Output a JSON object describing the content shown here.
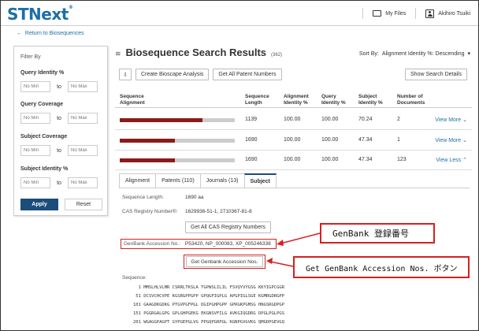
{
  "brand": {
    "logo": "STNext",
    "trademark": "®"
  },
  "topnav": {
    "my_files": "My Files",
    "user": "Akihiro Tsuiki"
  },
  "back_link": "Return to Biosequences",
  "filter": {
    "title": "Filter By",
    "sections": [
      {
        "label": "Query Identity %",
        "min_placeholder": "No Min",
        "max_placeholder": "No Max"
      },
      {
        "label": "Query Coverage",
        "min_placeholder": "No Min",
        "max_placeholder": "No Max"
      },
      {
        "label": "Subject Coverage",
        "min_placeholder": "No Min",
        "max_placeholder": "No Max"
      },
      {
        "label": "Subject Identity %",
        "min_placeholder": "No Min",
        "max_placeholder": "No Max"
      }
    ],
    "to_label": "to",
    "apply": "Apply",
    "reset": "Reset"
  },
  "results": {
    "title": "Biosequence Search Results",
    "count": "(362)",
    "sort_label": "Sort By:",
    "sort_value": "Alignment Identity %: Descending",
    "toolbar": {
      "create_bioscape": "Create Bioscape Analysis",
      "get_patent_numbers": "Get All Patent Numbers",
      "show_search_details": "Show Search Details"
    },
    "columns": {
      "alignment": [
        "Sequence",
        "Alignment"
      ],
      "length": [
        "Sequence",
        "Length"
      ],
      "align_identity": [
        "Alignment",
        "Identity %"
      ],
      "query_identity": [
        "Query",
        "Identity %"
      ],
      "subject_identity": [
        "Subject",
        "Identity %"
      ],
      "documents": [
        "Number of",
        "Documents"
      ]
    },
    "rows": [
      {
        "fill": 0.72,
        "length": "1139",
        "align_identity": "100.00",
        "query_identity": "100.00",
        "subject_identity": "70.24",
        "documents": "2",
        "link": "View More"
      },
      {
        "fill": 0.48,
        "length": "1690",
        "align_identity": "100.00",
        "query_identity": "100.00",
        "subject_identity": "47.34",
        "documents": "1",
        "link": "View More"
      },
      {
        "fill": 0.48,
        "length": "1690",
        "align_identity": "100.00",
        "query_identity": "100.00",
        "subject_identity": "47.34",
        "documents": "123",
        "link": "View Less"
      }
    ]
  },
  "detail": {
    "tabs": [
      "Alignment",
      "Patents (110)",
      "Journals (13)",
      "Subject"
    ],
    "active_tab": "Subject",
    "sequence_length_label": "Sequence Length:",
    "sequence_length_value": "1690 aa",
    "cas_label": "CAS Registry Number®:",
    "cas_value": "1629936-51-1, 2710367-81-8",
    "get_all_cas": "Get All CAS Registry Numbers",
    "genbank_label": "GenBank Accession No.:",
    "genbank_value": "P53420, NP_000083, XP_005246338",
    "get_genbank": "Get Genbank Accession Nos.",
    "sequence_label": "Sequence:",
    "sequence_lines": [
      "  1 MMSLHLVLMR CSRRLTKSLA TGPWSLILIL FSVQYVYGSG KKYIGPCGGR",
      " 51 DCSVCHCVPE KGSRGPPGPP GPQGPIGPLG APGPIGLSGE KGMRGDRGPP",
      "101 GAAGDKGDKG PTGVPGFPGL DGIPGHPGPP GPRGKPGMSG HNGSRGDPGP",
      "151 PGGRGALGPG GPLGHPGEKG EKGNSVFILG AVKGIQGDRG DPGLPGLPGS",
      "201 WGAGGPAGPT GYPGEPGLVG PPGQPGRPGL KGNPGVGVKG QMGDPGEVGQ"
    ]
  },
  "annotations": {
    "callout1": "GenBank 登録番号",
    "callout2": "Get GenBank Accession Nos. ボタン"
  }
}
